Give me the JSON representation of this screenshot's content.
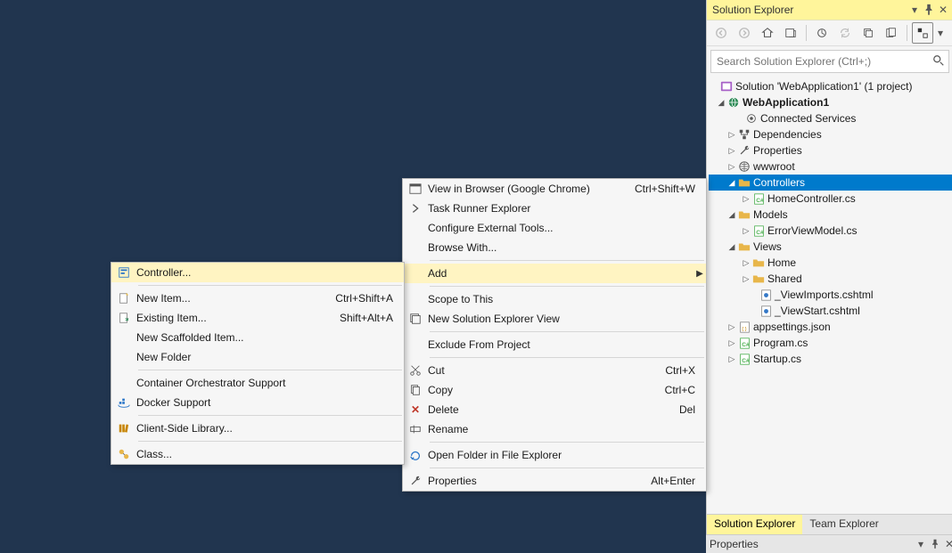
{
  "solutionExplorer": {
    "title": "Solution Explorer",
    "searchPlaceholder": "Search Solution Explorer (Ctrl+;)",
    "tabs": {
      "active": "Solution Explorer",
      "other": "Team Explorer"
    }
  },
  "tree": {
    "solution": "Solution 'WebApplication1' (1 project)",
    "project": "WebApplication1",
    "connectedServices": "Connected Services",
    "dependencies": "Dependencies",
    "properties": "Properties",
    "wwwroot": "wwwroot",
    "controllers": "Controllers",
    "homeController": "HomeController.cs",
    "models": "Models",
    "errorViewModel": "ErrorViewModel.cs",
    "views": "Views",
    "viewsHome": "Home",
    "viewsShared": "Shared",
    "viewImports": "_ViewImports.cshtml",
    "viewStart": "_ViewStart.cshtml",
    "appsettings": "appsettings.json",
    "program": "Program.cs",
    "startup": "Startup.cs"
  },
  "propertiesPanel": {
    "title": "Properties"
  },
  "ctxMain": {
    "viewInBrowser": {
      "label": "View in Browser (Google Chrome)",
      "shortcut": "Ctrl+Shift+W"
    },
    "taskRunner": "Task Runner Explorer",
    "configureTools": "Configure External Tools...",
    "browseWith": "Browse With...",
    "add": "Add",
    "scopeToThis": "Scope to This",
    "newSolutionView": "New Solution Explorer View",
    "excludeFromProject": "Exclude From Project",
    "cut": {
      "label": "Cut",
      "shortcut": "Ctrl+X"
    },
    "copy": {
      "label": "Copy",
      "shortcut": "Ctrl+C"
    },
    "delete": {
      "label": "Delete",
      "shortcut": "Del"
    },
    "rename": "Rename",
    "openInExplorer": "Open Folder in File Explorer",
    "properties": {
      "label": "Properties",
      "shortcut": "Alt+Enter"
    }
  },
  "ctxAdd": {
    "controller": "Controller...",
    "newItem": {
      "label": "New Item...",
      "shortcut": "Ctrl+Shift+A"
    },
    "existingItem": {
      "label": "Existing Item...",
      "shortcut": "Shift+Alt+A"
    },
    "newScaffolded": "New Scaffolded Item...",
    "newFolder": "New Folder",
    "containerSupport": "Container Orchestrator Support",
    "dockerSupport": "Docker Support",
    "clientSideLibrary": "Client-Side Library...",
    "class": "Class..."
  }
}
